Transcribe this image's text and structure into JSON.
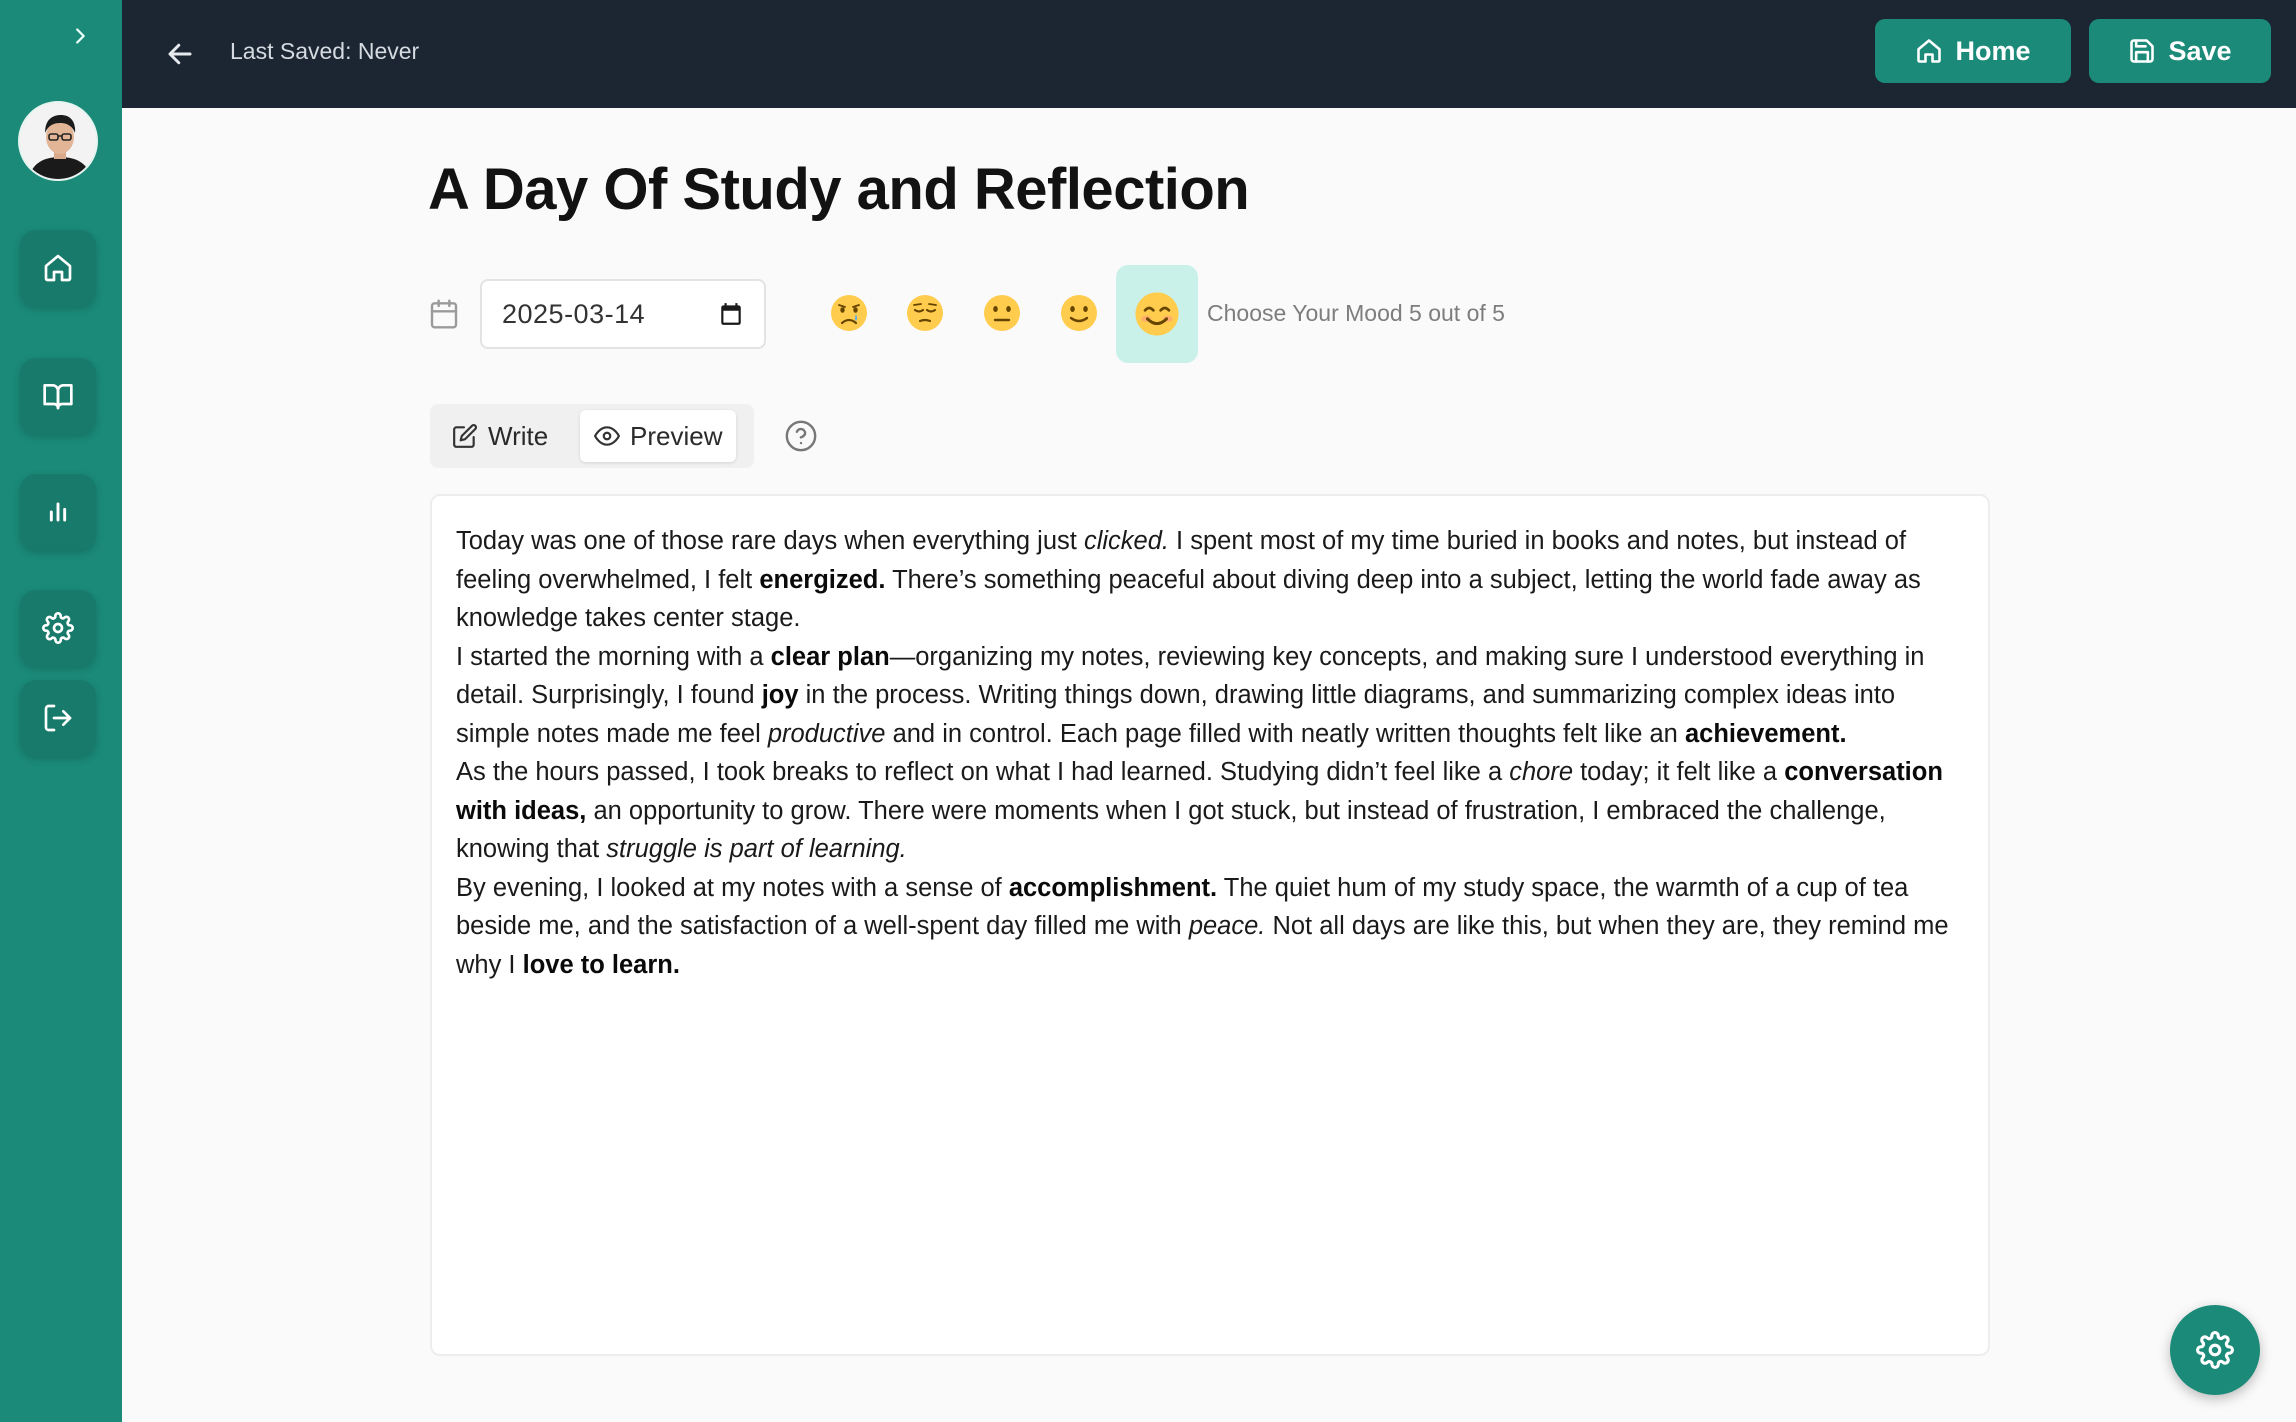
{
  "header": {
    "last_saved": "Last Saved: Never",
    "home_label": "Home",
    "save_label": "Save"
  },
  "sidebar": {
    "items": [
      {
        "icon": "home-icon"
      },
      {
        "icon": "book-icon"
      },
      {
        "icon": "bar-chart-icon"
      },
      {
        "icon": "gear-icon"
      },
      {
        "icon": "logout-icon"
      }
    ]
  },
  "entry": {
    "title": "A Day Of Study and Reflection",
    "date": "2025-03-14",
    "mood_label": "Choose Your Mood 5 out of 5",
    "mood_selected": 5,
    "moods": [
      "crying-face-icon",
      "pensive-face-icon",
      "neutral-face-icon",
      "slight-smile-icon",
      "happy-face-icon"
    ]
  },
  "tabs": {
    "write": "Write",
    "preview": "Preview",
    "active": "preview"
  },
  "content": {
    "p1": [
      "Today was one of those rare days when everything just ",
      "clicked.",
      " I spent most of my time buried in books and notes, but instead of feeling overwhelmed, I felt ",
      "energized.",
      " There’s something peaceful about diving deep into a subject, letting the world fade away as knowledge takes center stage."
    ],
    "p2": [
      "I started the morning with a ",
      "clear plan",
      "—organizing my notes, reviewing key concepts, and making sure I understood everything in detail. Surprisingly, I found ",
      "joy",
      " in the process. Writing things down, drawing little diagrams, and summarizing complex ideas into simple notes made me feel ",
      "productive",
      " and in control. Each page filled with neatly written thoughts felt like an ",
      "achievement."
    ],
    "p3": [
      "As the hours passed, I took breaks to reflect on what I had learned. Studying didn’t feel like a ",
      "chore",
      " today; it felt like a ",
      "conversation with ideas,",
      " an opportunity to grow. There were moments when I got stuck, but instead of frustration, I embraced the challenge, knowing that ",
      "struggle is part of learning."
    ],
    "p4": [
      "By evening, I looked at my notes with a sense of ",
      "accomplishment.",
      " The quiet hum of my study space, the warmth of a cup of tea beside me, and the satisfaction of a well-spent day filled me with ",
      "peace.",
      " Not all days are like this, but when they are, they remind me why I ",
      "love to learn."
    ]
  },
  "colors": {
    "sidebar": "#1b8a78",
    "header": "#1c2633",
    "accent": "#1b8a78",
    "mood_selected_bg": "#c9f1ea"
  }
}
